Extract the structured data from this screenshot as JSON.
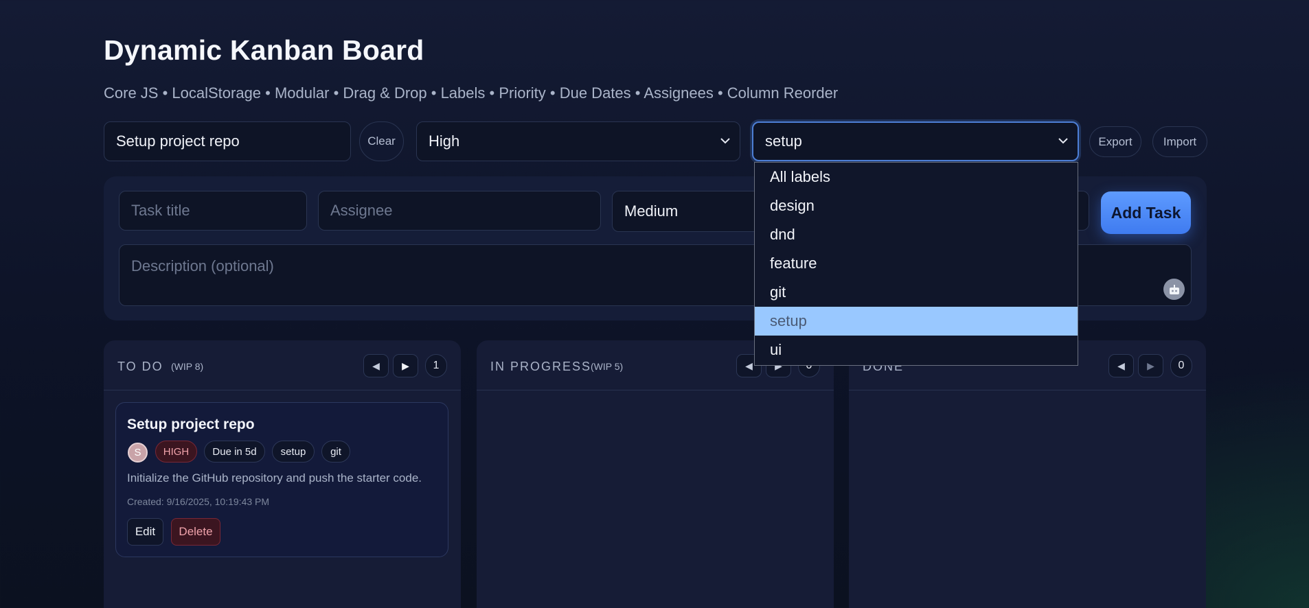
{
  "header": {
    "title": "Dynamic Kanban Board",
    "subtitle": "Core JS • LocalStorage • Modular • Drag & Drop • Labels • Priority • Due Dates • Assignees • Column Reorder"
  },
  "toolbar": {
    "search_value": "Setup project repo",
    "clear_label": "Clear",
    "priority_filter_value": "High",
    "label_filter_value": "setup",
    "export_label": "Export",
    "import_label": "Import"
  },
  "add_form": {
    "title_placeholder": "Task title",
    "assignee_placeholder": "Assignee",
    "priority_value": "Medium",
    "description_placeholder": "Description (optional)",
    "add_label": "Add Task"
  },
  "label_dropdown": {
    "options": [
      "All labels",
      "design",
      "dnd",
      "feature",
      "git",
      "setup",
      "ui"
    ],
    "selected": "setup"
  },
  "columns": [
    {
      "title": "TO DO",
      "wip": "(WIP 8)",
      "count": "1",
      "tasks": [
        {
          "title": "Setup project repo",
          "assignee_initial": "S",
          "priority": "HIGH",
          "due": "Due in 5d",
          "labels": [
            "setup",
            "git"
          ],
          "description": "Initialize the GitHub repository and push the starter code.",
          "created": "Created: 9/16/2025, 10:19:43 PM",
          "edit_label": "Edit",
          "delete_label": "Delete"
        }
      ]
    },
    {
      "title": "IN PROGRESS",
      "wip": "(WIP 5)",
      "count": "0",
      "tasks": []
    },
    {
      "title": "DONE",
      "wip": "",
      "count": "0",
      "tasks": []
    }
  ],
  "icons": {
    "left_arrow": "◀",
    "right_arrow": "▶",
    "chevron_down": "chevron-down-icon",
    "bot": "bot-icon"
  },
  "colors": {
    "accent": "#4d84f5",
    "high_priority": "#f0a3ab",
    "selected_option": "#99c8ff"
  }
}
